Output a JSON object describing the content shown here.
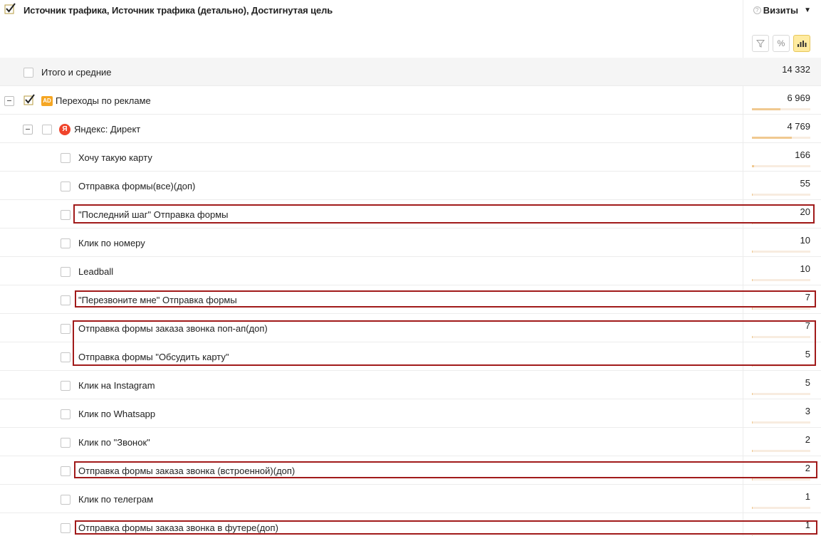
{
  "header": {
    "title": "Источник трафика, Источник трафика (детально), Достигнутая цель",
    "metric_label": "Визиты",
    "help_icon": "?",
    "caret": "▼"
  },
  "toolbar": {
    "filter_icon": "filter-icon",
    "percent_icon": "percent-icon",
    "chart_icon": "bar-chart-icon",
    "percent_glyph": "%"
  },
  "total": {
    "label": "Итого и средние",
    "value": "14 332"
  },
  "group": {
    "label": "Переходы по рекламе",
    "value": "6 969",
    "share": 0.486,
    "badge": "AD",
    "checked": true
  },
  "subgroup": {
    "label": "Яндекс: Директ",
    "value": "4 769",
    "share": 0.684,
    "icon": "Я"
  },
  "goals": [
    {
      "label": "Хочу такую карту",
      "value": "166",
      "share": 0.035,
      "highlighted": false
    },
    {
      "label": "Отправка формы(все)(доп)",
      "value": "55",
      "share": 0.012,
      "highlighted": false
    },
    {
      "label": "\"Последний шаг\" Отправка формы",
      "value": "20",
      "share": 0.004,
      "highlighted": true
    },
    {
      "label": "Клик по номеру",
      "value": "10",
      "share": 0.002,
      "highlighted": false
    },
    {
      "label": "Leadball",
      "value": "10",
      "share": 0.002,
      "highlighted": false
    },
    {
      "label": "\"Перезвоните мне\" Отправка формы",
      "value": "7",
      "share": 0.0015,
      "highlighted": true
    },
    {
      "label": "Отправка формы заказа звонка поп-ап(доп)",
      "value": "7",
      "share": 0.0015,
      "highlighted": true
    },
    {
      "label": "Отправка формы \"Обсудить карту\"",
      "value": "5",
      "share": 0.001,
      "highlighted": true
    },
    {
      "label": "Клик на Instagram",
      "value": "5",
      "share": 0.001,
      "highlighted": false
    },
    {
      "label": "Клик по Whatsapp",
      "value": "3",
      "share": 0.0006,
      "highlighted": false
    },
    {
      "label": "Клик по \"Звонок\"",
      "value": "2",
      "share": 0.0004,
      "highlighted": false
    },
    {
      "label": "Отправка формы заказа звонка (встроенной)(доп)",
      "value": "2",
      "share": 0.0004,
      "highlighted": true
    },
    {
      "label": "Клик по телеграм",
      "value": "1",
      "share": 0.0002,
      "highlighted": false
    },
    {
      "label": "Отправка формы заказа звонка в футере(доп)",
      "value": "1",
      "share": 0.0002,
      "highlighted": true
    }
  ],
  "colors": {
    "accent": "#ffeba0",
    "bar": "#f0c990",
    "highlight_border": "#a11a1a",
    "ad_badge": "#f5a623",
    "yandex": "#f0442b"
  }
}
